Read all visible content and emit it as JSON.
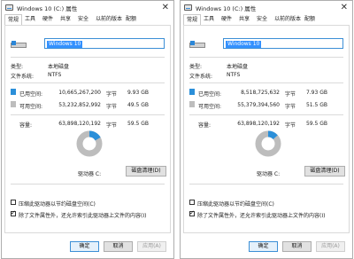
{
  "dialogs": [
    {
      "title": "Windows 10 (C:) 属性",
      "close_glyph": "✕",
      "tabs": [
        "常规",
        "工具",
        "硬件",
        "共享",
        "安全",
        "以前的版本",
        "配额"
      ],
      "active_tab": "常规",
      "drive_name": "Windows 10",
      "type_label": "类型:",
      "type_value": "本地磁盘",
      "fs_label": "文件系统:",
      "fs_value": "NTFS",
      "used_label": "已用空间:",
      "used_bytes": "10,665,267,200",
      "used_unit": "字节",
      "used_gb": "9.93 GB",
      "free_label": "可用空间:",
      "free_bytes": "53,232,852,992",
      "free_unit": "字节",
      "free_gb": "49.5 GB",
      "cap_label": "容量:",
      "cap_bytes": "63,898,120,192",
      "cap_unit": "字节",
      "cap_gb": "59.5 GB",
      "used_fraction": 0.167,
      "drive_letter_label": "驱动器 C:",
      "cleanup_button": "磁盘清理(D)",
      "compress_label": "压缩此驱动器以节约磁盘空间(C)",
      "compress_checked": false,
      "index_label": "除了文件属性外，还允许索引此驱动器上文件的内容(I)",
      "index_checked": true,
      "ok_button": "确定",
      "cancel_button": "取消",
      "apply_button": "应用(A)"
    },
    {
      "title": "Windows 10 (C:) 属性",
      "close_glyph": "✕",
      "tabs": [
        "常规",
        "工具",
        "硬件",
        "共享",
        "安全",
        "以前的版本",
        "配额"
      ],
      "active_tab": "常规",
      "drive_name": "Windows 10",
      "type_label": "类型:",
      "type_value": "本地磁盘",
      "fs_label": "文件系统:",
      "fs_value": "NTFS",
      "used_label": "已用空间:",
      "used_bytes": "8,518,725,632",
      "used_unit": "字节",
      "used_gb": "7.93 GB",
      "free_label": "可用空间:",
      "free_bytes": "55,379,394,560",
      "free_unit": "字节",
      "free_gb": "51.5 GB",
      "cap_label": "容量:",
      "cap_bytes": "63,898,120,192",
      "cap_unit": "字节",
      "cap_gb": "59.5 GB",
      "used_fraction": 0.133,
      "drive_letter_label": "驱动器 C:",
      "cleanup_button": "磁盘清理(D)",
      "compress_label": "压缩此驱动器以节约磁盘空间(C)",
      "compress_checked": false,
      "index_label": "除了文件属性外，还允许索引此驱动器上文件的内容(I)",
      "index_checked": true,
      "ok_button": "确定",
      "cancel_button": "取消",
      "apply_button": "应用(A)"
    }
  ],
  "colors": {
    "used": "#2b8fd9",
    "free": "#bdbdbd",
    "accent": "#3391ff"
  }
}
